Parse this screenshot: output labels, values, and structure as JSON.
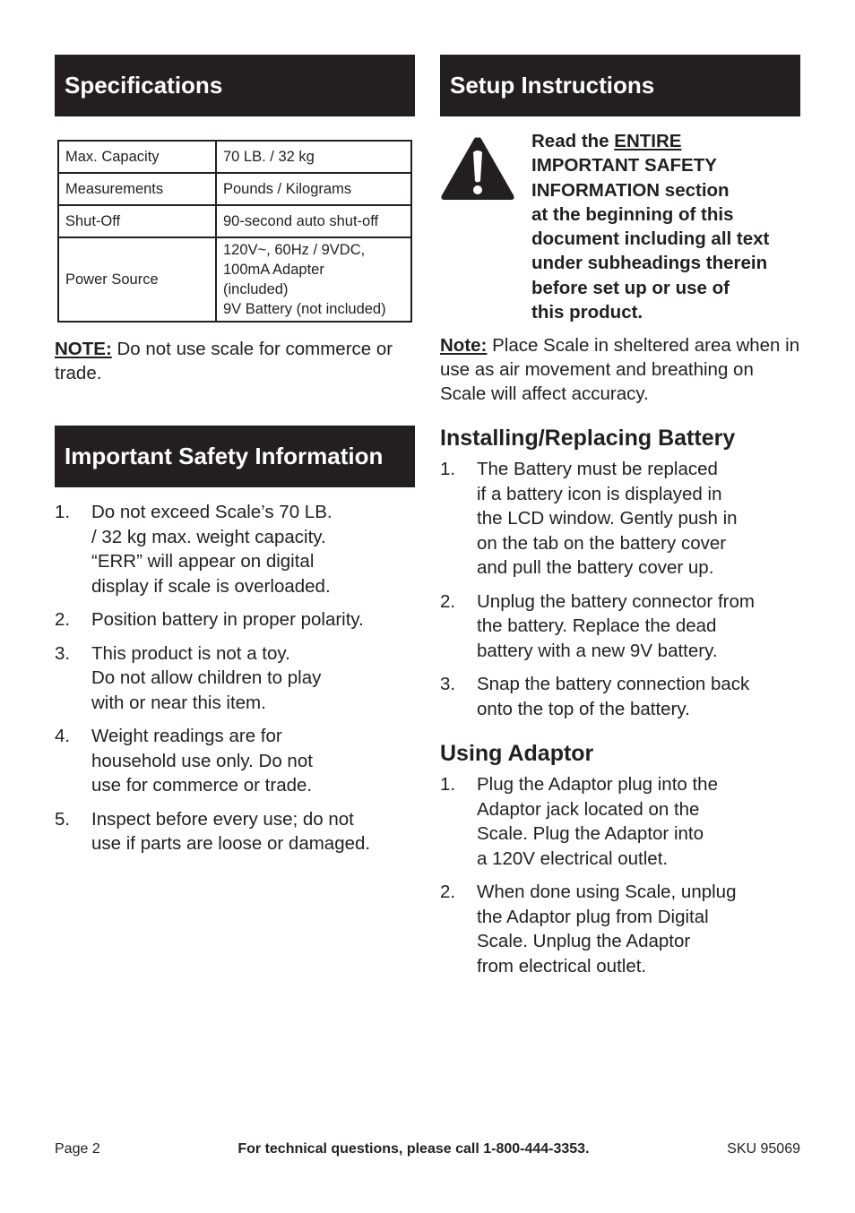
{
  "specifications": {
    "title": "Specifications",
    "rows": [
      {
        "label": "Max. Capacity",
        "value": "70 LB. / 32 kg"
      },
      {
        "label": "Measurements",
        "value": "Pounds / Kilograms"
      },
      {
        "label": "Shut-Off",
        "value": "90-second auto shut-off"
      },
      {
        "label": "Power Source",
        "value": "120V~, 60Hz / 9VDC,\n100mA Adapter\n(included)\n9V Battery (not included)"
      }
    ],
    "note_label": "NOTE:",
    "note_text": " Do not use scale for commerce or trade."
  },
  "safety": {
    "title": "Important Safety Information",
    "items": [
      {
        "num": "1.",
        "text": "Do not exceed Scale’s 70 LB.\n/ 32 kg max. weight capacity.\n“ERR” will appear on digital\ndisplay if scale is overloaded."
      },
      {
        "num": "2.",
        "text": "Position battery in proper polarity."
      },
      {
        "num": "3.",
        "text": "This product is not a toy.\nDo not allow children to play\nwith or near this item."
      },
      {
        "num": "4.",
        "text": "Weight readings are for\nhousehold use only.  Do not\nuse for commerce or trade."
      },
      {
        "num": "5.",
        "text": "Inspect before every use; do not\nuse if parts are loose or damaged."
      }
    ]
  },
  "setup": {
    "title": "Setup Instructions",
    "warning_prefix": "Read the ",
    "warning_underlined": "ENTIRE",
    "warning_rest": "\nIMPORTANT SAFETY\nINFORMATION section\nat the beginning of this\ndocument including all text\nunder subheadings therein\nbefore set up or use of\nthis product.",
    "note_label": "Note:",
    "note_text": " Place Scale in sheltered area when in use as air movement and breathing on Scale will affect accuracy.",
    "battery": {
      "title": "Installing/Replacing Battery",
      "items": [
        {
          "num": "1.",
          "text": "The Battery must be replaced\nif a battery icon is displayed in\nthe LCD window. Gently push in\non the tab on the battery cover\nand pull the battery cover up."
        },
        {
          "num": "2.",
          "text": "Unplug the battery connector from\nthe battery.  Replace the dead\nbattery with a new 9V battery."
        },
        {
          "num": "3.",
          "text": "Snap the battery connection back\nonto the top of the battery."
        }
      ]
    },
    "adaptor": {
      "title": "Using Adaptor",
      "items": [
        {
          "num": "1.",
          "text": "Plug the Adaptor plug into the\nAdaptor jack located on the\nScale. Plug the Adaptor into\na 120V electrical outlet."
        },
        {
          "num": "2.",
          "text": "When done using Scale, unplug\nthe Adaptor plug from Digital\nScale.  Unplug the Adaptor\nfrom electrical outlet."
        }
      ]
    }
  },
  "footer": {
    "page": "Page 2",
    "support": "For technical questions, please call 1-800-444-3353.",
    "sku": "SKU 95069"
  }
}
